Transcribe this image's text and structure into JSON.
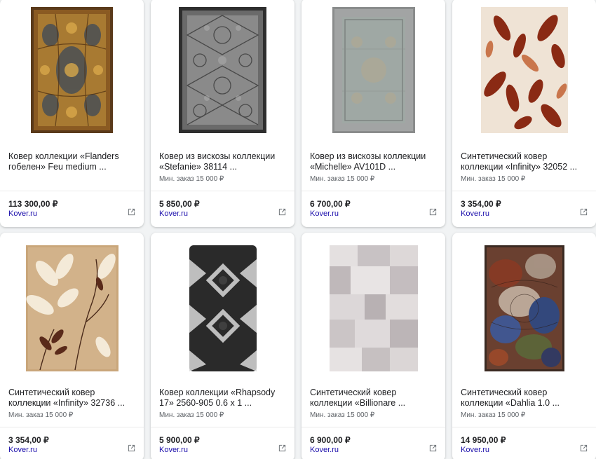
{
  "products": [
    {
      "title_line1": "Ковер коллекции «Flanders",
      "title_line2": "гобелен» Feu medium ...",
      "moq": "",
      "price": "113 300,00 ₽",
      "merchant": "Kover.ru",
      "image_icon": "rug-tapestry-image"
    },
    {
      "title_line1": "Ковер из вискозы коллекции",
      "title_line2": "«Stefanie» 38114 ...",
      "moq": "Мин. заказ 15 000 ₽",
      "price": "5 850,00 ₽",
      "merchant": "Kover.ru",
      "image_icon": "rug-grey-ornament-image"
    },
    {
      "title_line1": "Ковер из вискозы коллекции",
      "title_line2": "«Michelle» AV101D ...",
      "moq": "Мин. заказ 15 000 ₽",
      "price": "6 700,00 ₽",
      "merchant": "Kover.ru",
      "image_icon": "rug-grey-border-image"
    },
    {
      "title_line1": "Синтетический ковер",
      "title_line2": "коллекции «Infinity» 32052 ...",
      "moq": "Мин. заказ 15 000 ₽",
      "price": "3 354,00 ₽",
      "merchant": "Kover.ru",
      "image_icon": "rug-red-leaves-image"
    },
    {
      "title_line1": "Синтетический ковер",
      "title_line2": "коллекции «Infinity» 32736 ...",
      "moq": "Мин. заказ 15 000 ₽",
      "price": "3 354,00 ₽",
      "merchant": "Kover.ru",
      "image_icon": "rug-beige-leaves-image"
    },
    {
      "title_line1": "Ковер коллекции «Rhapsody",
      "title_line2": "17» 2560-905 0.6 x 1 ...",
      "moq": "Мин. заказ 15 000 ₽",
      "price": "5 900,00 ₽",
      "merchant": "Kover.ru",
      "image_icon": "rug-shaggy-diamond-image"
    },
    {
      "title_line1": "Синтетический ковер",
      "title_line2": "коллекции «Billionare ...",
      "moq": "Мин. заказ 15 000 ₽",
      "price": "6 900,00 ₽",
      "merchant": "Kover.ru",
      "image_icon": "rug-patchwork-image"
    },
    {
      "title_line1": "Синтетический ковер",
      "title_line2": "коллекции «Dahlia 1.0 ...",
      "moq": "Мин. заказ 15 000 ₽",
      "price": "14 950,00 ₽",
      "merchant": "Kover.ru",
      "image_icon": "rug-vintage-blue-image"
    }
  ],
  "colors": {
    "merchant_link": "#1a0dab",
    "price_text": "#202124",
    "card_bg": "#ffffff",
    "page_bg": "#f1f3f4"
  }
}
